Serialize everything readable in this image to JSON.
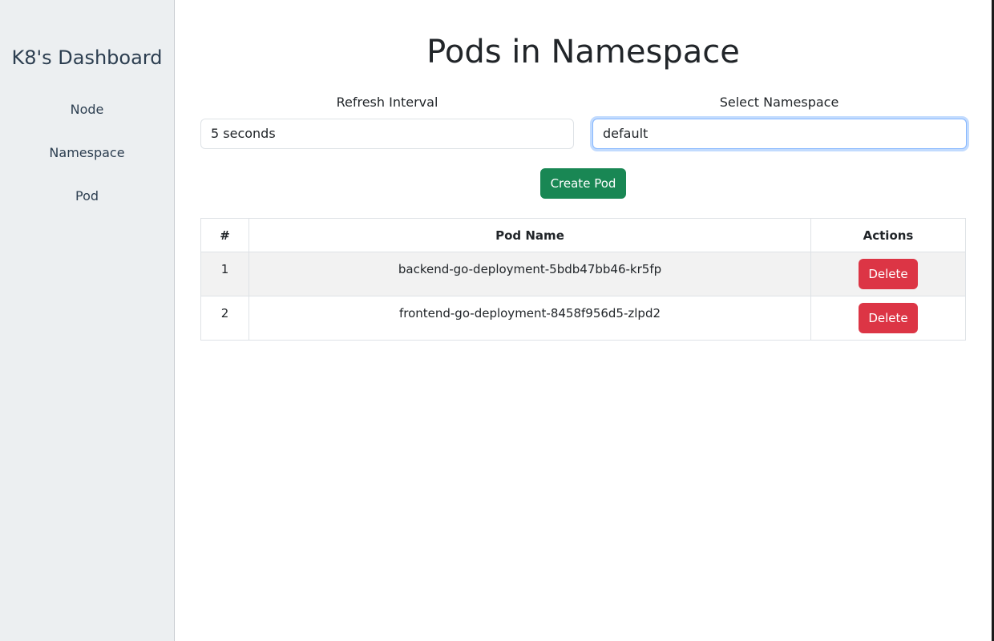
{
  "sidebar": {
    "brand": "K8's Dashboard",
    "items": [
      {
        "label": "Node"
      },
      {
        "label": "Namespace"
      },
      {
        "label": "Pod"
      }
    ]
  },
  "main": {
    "title": "Pods in Namespace",
    "refresh": {
      "label": "Refresh Interval",
      "value": "5 seconds"
    },
    "namespace": {
      "label": "Select Namespace",
      "value": "default"
    },
    "create_button": "Create Pod",
    "table": {
      "headers": [
        "#",
        "Pod Name",
        "Actions"
      ],
      "rows": [
        {
          "num": "1",
          "name": "backend-go-deployment-5bdb47bb46-kr5fp",
          "action": "Delete"
        },
        {
          "num": "2",
          "name": "frontend-go-deployment-8458f956d5-zlpd2",
          "action": "Delete"
        }
      ]
    }
  },
  "colors": {
    "sidebar_bg": "#eceff1",
    "create_button": "#198754",
    "delete_button": "#dc3545",
    "focus_ring": "#86b7fe"
  }
}
